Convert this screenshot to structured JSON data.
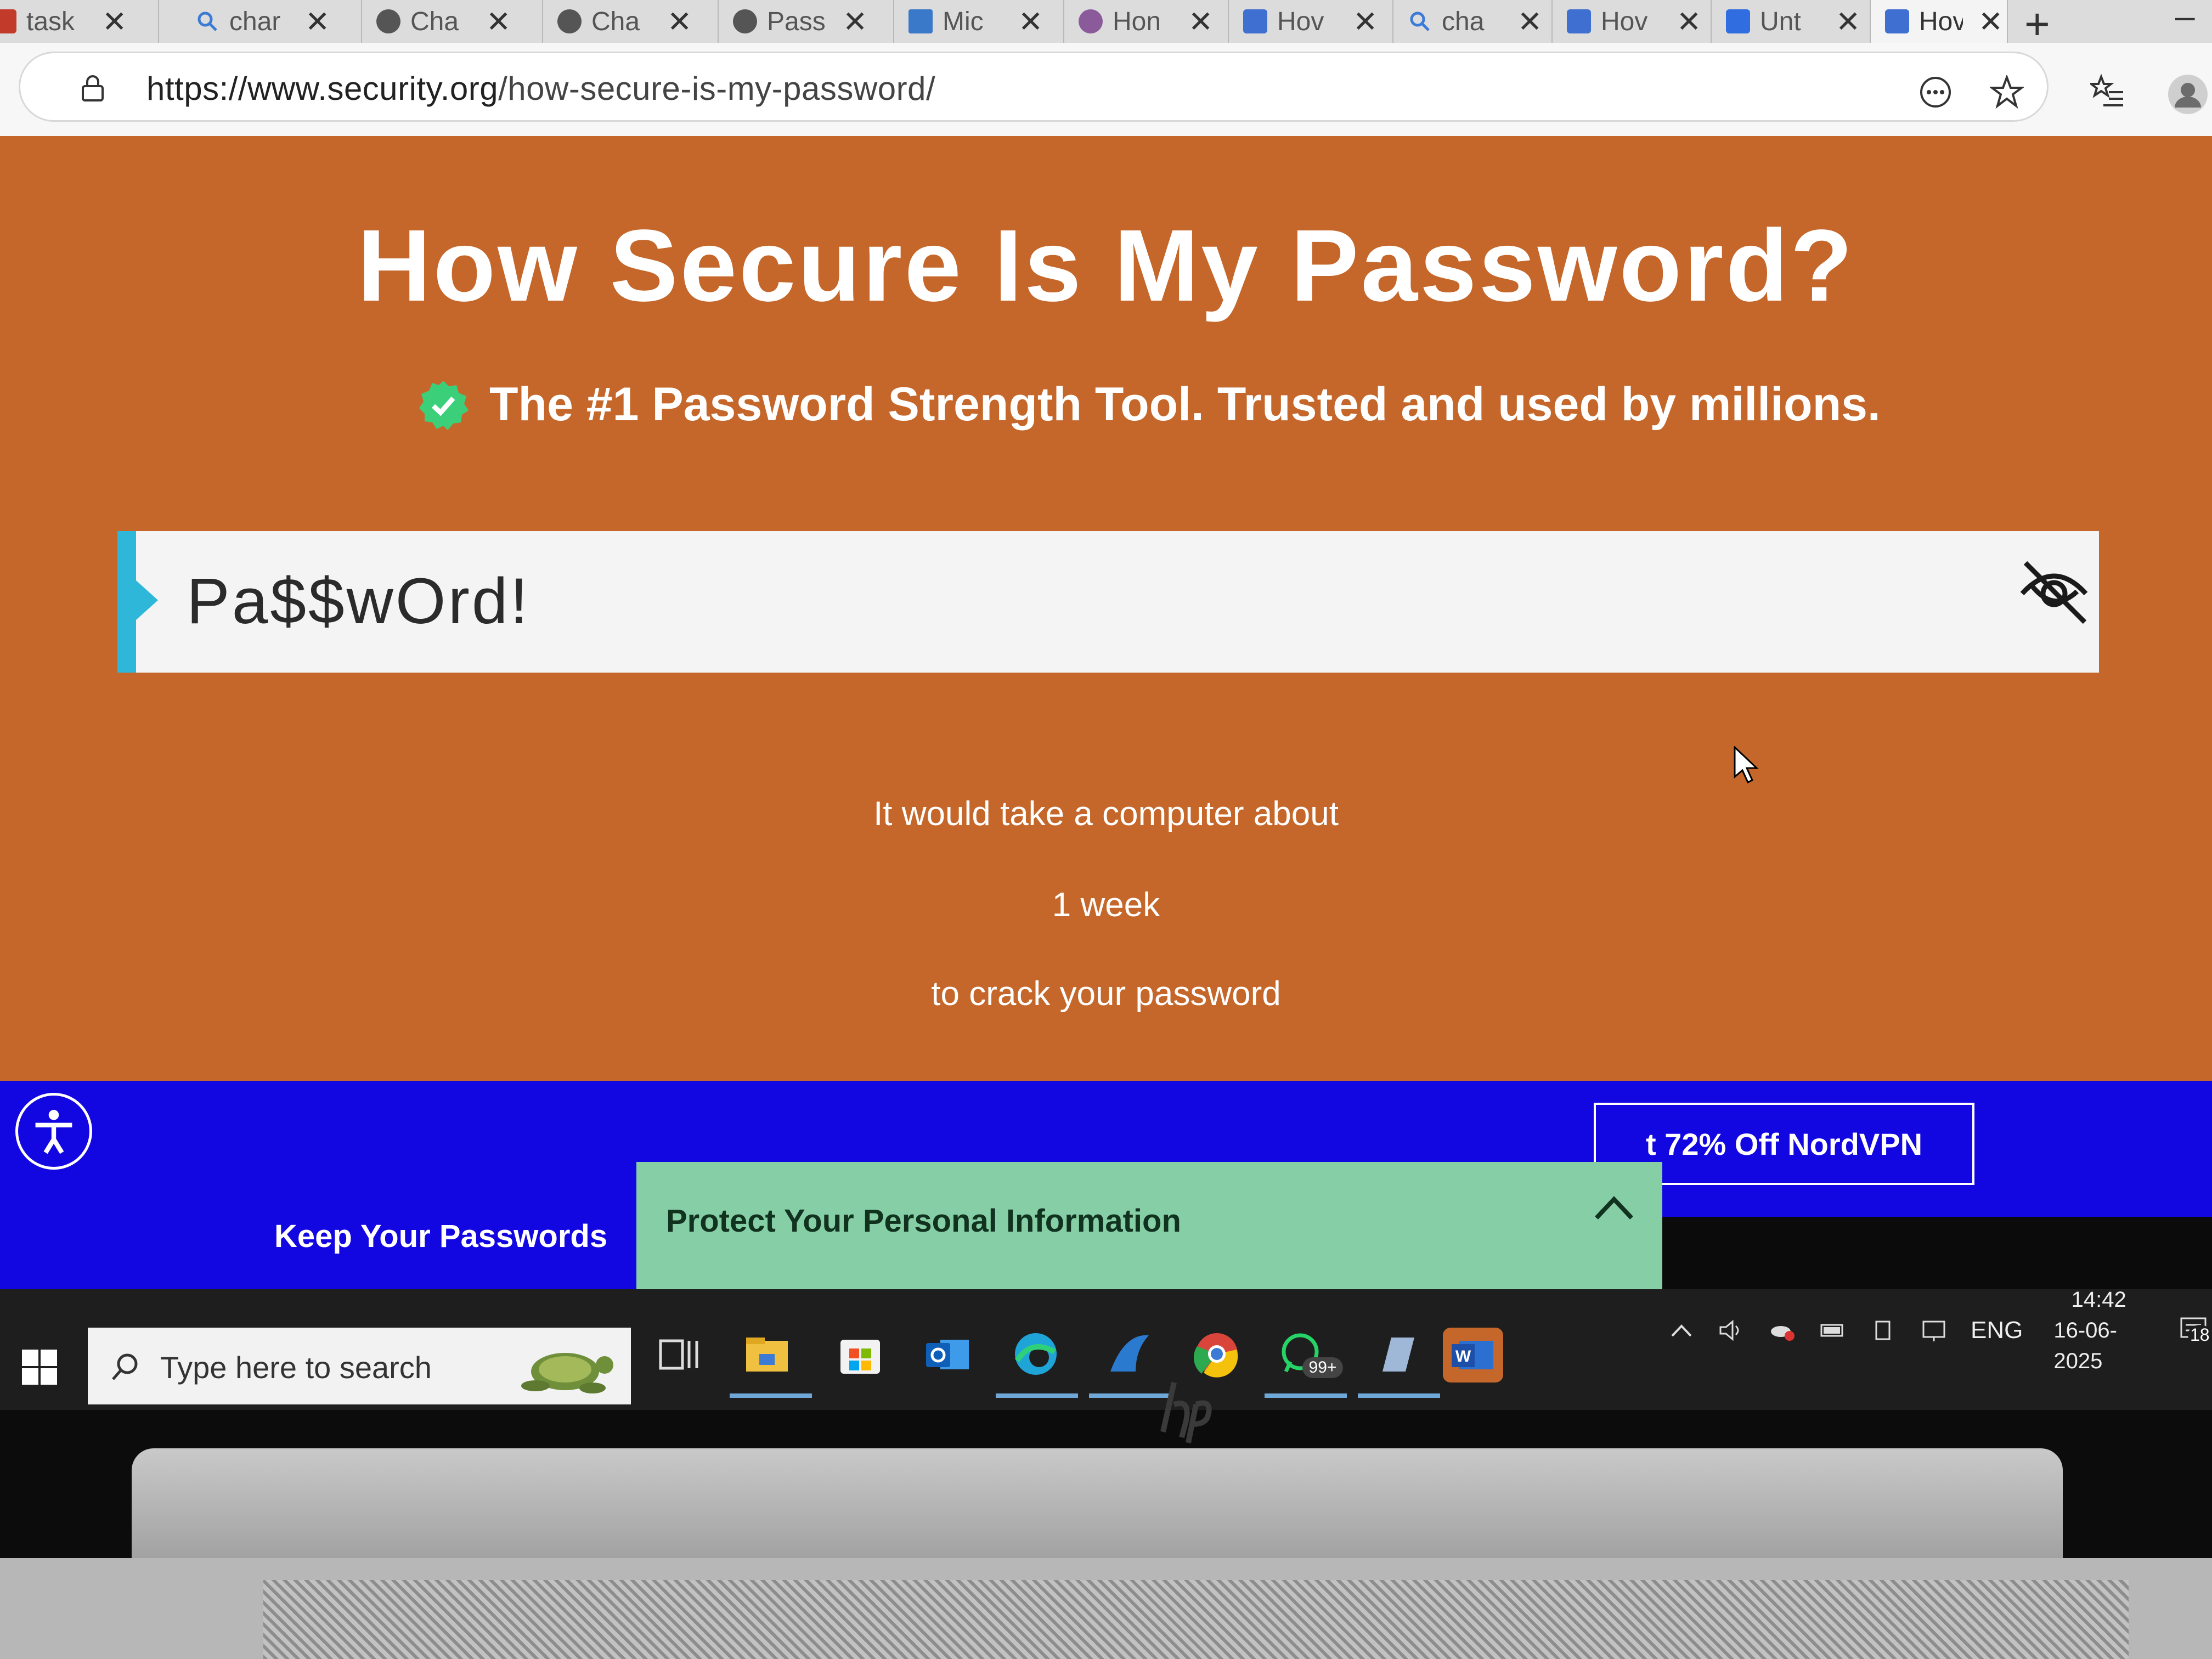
{
  "browser": {
    "tabs": [
      {
        "title": "task",
        "icon": "app-icon",
        "active": false
      },
      {
        "title": "char",
        "icon": "search-tab-icon",
        "active": false
      },
      {
        "title": "Cha",
        "icon": "chatgpt-icon",
        "active": false
      },
      {
        "title": "Cha",
        "icon": "chatgpt-icon",
        "active": false
      },
      {
        "title": "Pass",
        "icon": "chatgpt-icon",
        "active": false
      },
      {
        "title": "Mic",
        "icon": "bookmark-icon",
        "active": false
      },
      {
        "title": "Hon",
        "icon": "site-icon",
        "active": false
      },
      {
        "title": "Hov",
        "icon": "security-org-icon",
        "active": false
      },
      {
        "title": "cha",
        "icon": "search-tab-icon",
        "active": false
      },
      {
        "title": "Hov",
        "icon": "security-org-icon",
        "active": false
      },
      {
        "title": "Unt",
        "icon": "docs-icon",
        "active": false
      },
      {
        "title": "Hov",
        "icon": "security-org-icon",
        "active": true
      }
    ],
    "tab_close": "✕",
    "new_tab": "+",
    "url_host": "https://www.security.org",
    "url_path": "/how-secure-is-my-password/"
  },
  "page": {
    "title": "How Secure Is My Password?",
    "subtitle": "The #1 Password Strength Tool. Trusted and used by millions.",
    "password_value": "Pa$$wOrd!",
    "result_line1": "It would take a computer about",
    "result_time": "1 week",
    "result_line3": "to crack your password"
  },
  "banner": {
    "nord_label": "t 72% Off NordVPN",
    "keep_label": "Keep Your Passwords",
    "protect_label": "Protect Your Personal Information"
  },
  "taskbar": {
    "search_placeholder": "Type here to search",
    "whatsapp_badge": "99+",
    "language": "ENG",
    "time": "14:42",
    "date": "16-06-2025",
    "notifications": "18"
  },
  "colors": {
    "page_bg": "#c5672a",
    "banner_blue": "#1207e0",
    "accent_cyan": "#2fb7d9",
    "check_green": "#3ccf7a",
    "protect_green": "#86cfa6"
  }
}
